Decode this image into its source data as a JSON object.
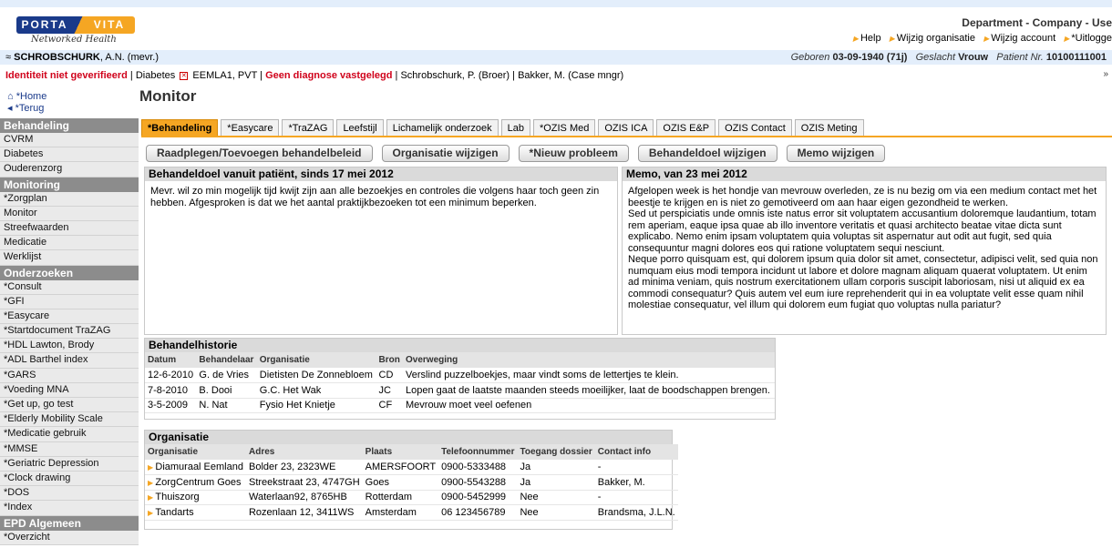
{
  "header": {
    "logo": {
      "left": "PORTA",
      "right": "VITA",
      "tagline": "Networked Health"
    },
    "department": "Department - Company - Use",
    "links": [
      "Help",
      "Wijzig organisatie",
      "Wijzig account",
      "*Uitlogge"
    ]
  },
  "patient": {
    "name_bold": "SCHROBSCHURK",
    "name_rest": ", A.N. (mevr.)",
    "born_label": "Geboren",
    "born_value": "03-09-1940 (71j)",
    "gender_label": "Geslacht",
    "gender_value": "Vrouw",
    "patient_nr_label": "Patient Nr.",
    "patient_nr_value": "10100111001"
  },
  "status": {
    "identity": "Identiteit niet geverifieerd",
    "diabetes": "Diabetes",
    "eemla": "EEMLA1, PVT",
    "diagnosis": "Geen diagnose vastgelegd",
    "contact1": "Schrobschurk, P. (Broer)",
    "contact2": "Bakker, M. (Case mngr)"
  },
  "nav": {
    "home": "*Home",
    "back": "*Terug"
  },
  "page_title": "Monitor",
  "sidebar": [
    {
      "head": "Behandeling",
      "items": [
        "CVRM",
        "Diabetes",
        "Ouderenzorg"
      ]
    },
    {
      "head": "Monitoring",
      "items": [
        "*Zorgplan",
        "Monitor",
        "Streefwaarden",
        "Medicatie",
        "Werklijst"
      ]
    },
    {
      "head": "Onderzoeken",
      "items": [
        "*Consult",
        "*GFI",
        "*Easycare",
        "*Startdocument TraZAG",
        "*HDL Lawton, Brody",
        "*ADL Barthel index",
        "*GARS",
        "*Voeding MNA",
        "*Get up, go test",
        "*Elderly Mobility Scale",
        "*Medicatie gebruik",
        "*MMSE",
        "*Geriatric Depression",
        "*Clock drawing",
        "*DOS",
        "*Index"
      ]
    },
    {
      "head": "EPD Algemeen",
      "items": [
        "*Overzicht"
      ]
    }
  ],
  "tabs": [
    "*Behandeling",
    "*Easycare",
    "*TraZAG",
    "Leefstijl",
    "Lichamelijk onderzoek",
    "Lab",
    "*OZIS Med",
    "OZIS ICA",
    "OZIS E&P",
    "OZIS Contact",
    "OZIS Meting"
  ],
  "actions": [
    "Raadplegen/Toevoegen behandelbeleid",
    "Organisatie wijzigen",
    "*Nieuw probleem",
    "Behandeldoel wijzigen",
    "Memo wijzigen"
  ],
  "goal": {
    "title": "Behandeldoel vanuit patiënt, sinds 17 mei 2012",
    "text": "Mevr. wil zo min mogelijk tijd kwijt zijn aan alle bezoekjes en controles die volgens haar toch geen zin hebben. Afgesproken is dat we het aantal praktijkbezoeken tot een minimum beperken."
  },
  "memo": {
    "title": "Memo, van 23 mei 2012",
    "paragraphs": [
      "Afgelopen week is het hondje van mevrouw overleden, ze is nu bezig om via een medium contact met het beestje te krijgen en is niet zo gemotiveerd om aan haar eigen gezondheid te werken.",
      "Sed ut perspiciatis unde omnis iste natus error sit voluptatem accusantium doloremque laudantium, totam rem aperiam, eaque ipsa quae ab illo inventore veritatis et quasi architecto beatae vitae dicta sunt explicabo. Nemo enim ipsam voluptatem quia voluptas sit aspernatur aut odit aut fugit, sed quia consequuntur magni dolores eos qui ratione voluptatem sequi nesciunt.",
      "Neque porro quisquam est, qui dolorem ipsum quia dolor sit amet, consectetur, adipisci velit, sed quia non numquam eius modi tempora incidunt ut labore et dolore magnam aliquam quaerat voluptatem. Ut enim ad minima veniam, quis nostrum exercitationem ullam corporis suscipit laboriosam, nisi ut aliquid ex ea commodi consequatur? Quis autem vel eum iure reprehenderit qui in ea voluptate velit esse quam nihil molestiae consequatur, vel illum qui dolorem eum fugiat quo voluptas nulla pariatur?"
    ]
  },
  "history": {
    "title": "Behandelhistorie",
    "columns": [
      "Datum",
      "Behandelaar",
      "Organisatie",
      "Bron",
      "Overweging"
    ],
    "rows": [
      [
        "12-6-2010",
        "G. de Vries",
        "Dietisten De Zonnebloem",
        "CD",
        "Verslind puzzelboekjes, maar vindt soms de lettertjes te klein."
      ],
      [
        "7-8-2010",
        "B. Dooi",
        "G.C. Het Wak",
        "JC",
        "Lopen gaat de laatste maanden steeds moeilijker, laat de boodschappen brengen."
      ],
      [
        "3-5-2009",
        "N. Nat",
        "Fysio Het Knietje",
        "CF",
        "Mevrouw moet veel oefenen"
      ]
    ]
  },
  "organisation": {
    "title": "Organisatie",
    "columns": [
      "Organisatie",
      "Adres",
      "Plaats",
      "Telefoonnummer",
      "Toegang dossier",
      "Contact info"
    ],
    "rows": [
      [
        "Diamuraal Eemland",
        "Bolder 23, 2323WE",
        "AMERSFOORT",
        "0900-5333488",
        "Ja",
        "-"
      ],
      [
        "ZorgCentrum Goes",
        "Streekstraat 23, 4747GH",
        "Goes",
        "0900-5543288",
        "Ja",
        "Bakker, M."
      ],
      [
        "Thuiszorg",
        "Waterlaan92, 8765HB",
        "Rotterdam",
        "0900-5452999",
        "Nee",
        "-"
      ],
      [
        "Tandarts",
        "Rozenlaan 12, 3411WS",
        "Amsterdam",
        "06 123456789",
        "Nee",
        "Brandsma, J.L.N."
      ]
    ]
  }
}
